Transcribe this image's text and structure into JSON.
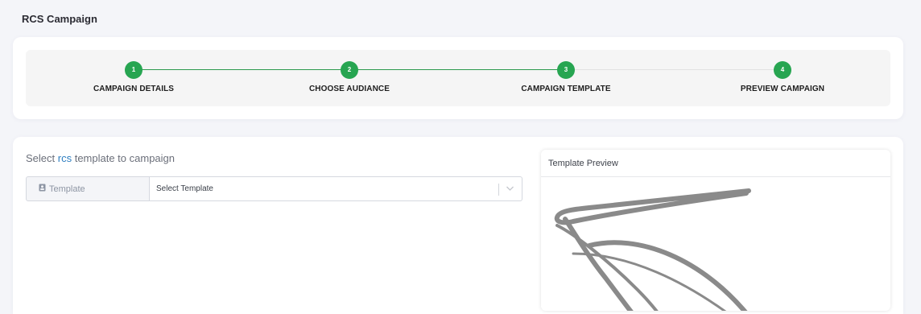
{
  "page": {
    "title": "RCS Campaign"
  },
  "stepper": {
    "steps": [
      {
        "number": "1",
        "label": "CAMPAIGN DETAILS"
      },
      {
        "number": "2",
        "label": "CHOOSE AUDIANCE"
      },
      {
        "number": "3",
        "label": "CAMPAIGN TEMPLATE"
      },
      {
        "number": "4",
        "label": "PREVIEW CAMPAIGN"
      }
    ],
    "current_step": 3,
    "colors": {
      "active": "#27a551",
      "line_done": "#2e9a4e",
      "line_todo": "#e1e1e1"
    }
  },
  "template_section": {
    "heading_prefix": "Select ",
    "heading_accent": "rcs",
    "heading_suffix": " template to campaign",
    "addon_label": "Template",
    "addon_icon": "contact-card-icon",
    "select_value": "Select Template",
    "select_icon": "chevron-down-icon"
  },
  "preview": {
    "title": "Template Preview"
  },
  "colors": {
    "accent": "#2f7fc1",
    "background": "#f4f5f9"
  }
}
